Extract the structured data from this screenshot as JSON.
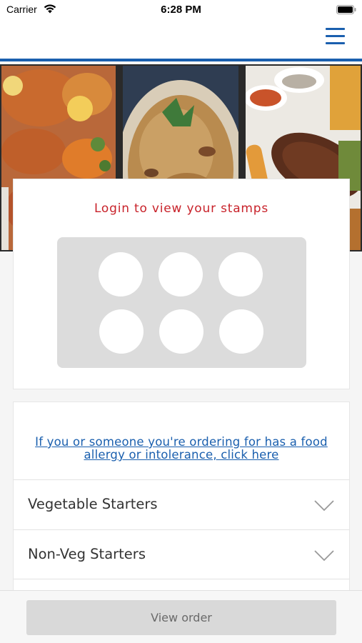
{
  "status_bar": {
    "carrier": "Carrier",
    "time": "6:28 PM",
    "icons": [
      "wifi-icon",
      "battery-icon"
    ]
  },
  "header": {
    "menu_icon": "hamburger-menu-icon",
    "accent_color": "#1a5fae"
  },
  "banner": {
    "images": [
      "roast-chicken-with-vegetables",
      "biryani-with-mint",
      "grilled-kebab-with-chips"
    ]
  },
  "stamps": {
    "login_text": "Login to view your stamps",
    "stamp_count": 6,
    "text_color": "#c8222a"
  },
  "menu": {
    "allergy_link": "If you or someone you're ordering for has a food allergy or intolerance, click here",
    "categories": [
      {
        "label": "Vegetable Starters",
        "icon": "chevron-down-icon"
      },
      {
        "label": "Non-Veg Starters",
        "icon": "chevron-down-icon"
      }
    ]
  },
  "footer": {
    "view_order_label": "View order"
  }
}
